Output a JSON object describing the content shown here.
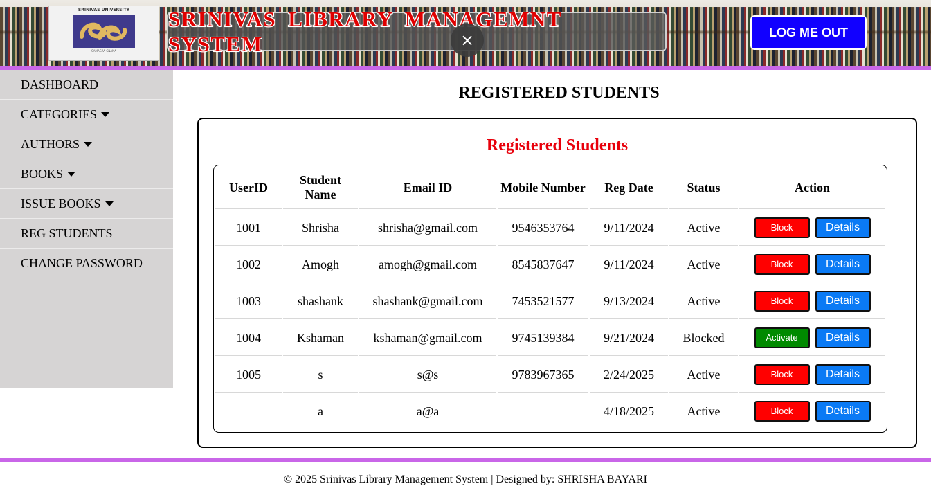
{
  "header": {
    "logo_top": "SRINIVAS UNIVERSITY",
    "logo_bottom": "SAMAGRA GNANA",
    "title": "SRINIVAS LIBRARY MANAGEMNT SYSTEM",
    "close_symbol": "×",
    "logout_label": "LOG ME OUT"
  },
  "sidebar": {
    "items": [
      {
        "label": "DASHBOARD",
        "has_caret": false
      },
      {
        "label": "CATEGORIES",
        "has_caret": true
      },
      {
        "label": "AUTHORS",
        "has_caret": true
      },
      {
        "label": "BOOKS",
        "has_caret": true
      },
      {
        "label": "ISSUE BOOKS",
        "has_caret": true
      },
      {
        "label": "REG STUDENTS",
        "has_caret": false
      },
      {
        "label": "CHANGE PASSWORD",
        "has_caret": false
      }
    ]
  },
  "main": {
    "page_title": "REGISTERED STUDENTS",
    "card_title": "Registered Students",
    "columns": [
      "UserID",
      "Student Name",
      "Email ID",
      "Mobile Number",
      "Reg Date",
      "Status",
      "Action"
    ],
    "rows": [
      {
        "userid": "1001",
        "name": "Shrisha",
        "email": "shrisha@gmail.com",
        "mobile": "9546353764",
        "reg_date": "9/11/2024",
        "status": "Active",
        "action": "Block",
        "details": "Details"
      },
      {
        "userid": "1002",
        "name": "Amogh",
        "email": "amogh@gmail.com",
        "mobile": "8545837647",
        "reg_date": "9/11/2024",
        "status": "Active",
        "action": "Block",
        "details": "Details"
      },
      {
        "userid": "1003",
        "name": "shashank",
        "email": "shashank@gmail.com",
        "mobile": "7453521577",
        "reg_date": "9/13/2024",
        "status": "Active",
        "action": "Block",
        "details": "Details"
      },
      {
        "userid": "1004",
        "name": "Kshaman",
        "email": "kshaman@gmail.com",
        "mobile": "9745139384",
        "reg_date": "9/21/2024",
        "status": "Blocked",
        "action": "Activate",
        "details": "Details"
      },
      {
        "userid": "1005",
        "name": "s",
        "email": "s@s",
        "mobile": "9783967365",
        "reg_date": "2/24/2025",
        "status": "Active",
        "action": "Block",
        "details": "Details"
      },
      {
        "userid": "",
        "name": "a",
        "email": "a@a",
        "mobile": "",
        "reg_date": "4/18/2025",
        "status": "Active",
        "action": "Block",
        "details": "Details"
      }
    ]
  },
  "footer": {
    "text": "© 2025 Srinivas Library Management System | Designed by: SHRISHA BAYARI"
  },
  "colors": {
    "accent_purple": "#c966e8",
    "logout_blue": "#1100ff",
    "block_red": "#ff0000",
    "activate_green": "#008a00",
    "details_blue": "#0a7af5",
    "card_title_red": "#e8000b"
  }
}
